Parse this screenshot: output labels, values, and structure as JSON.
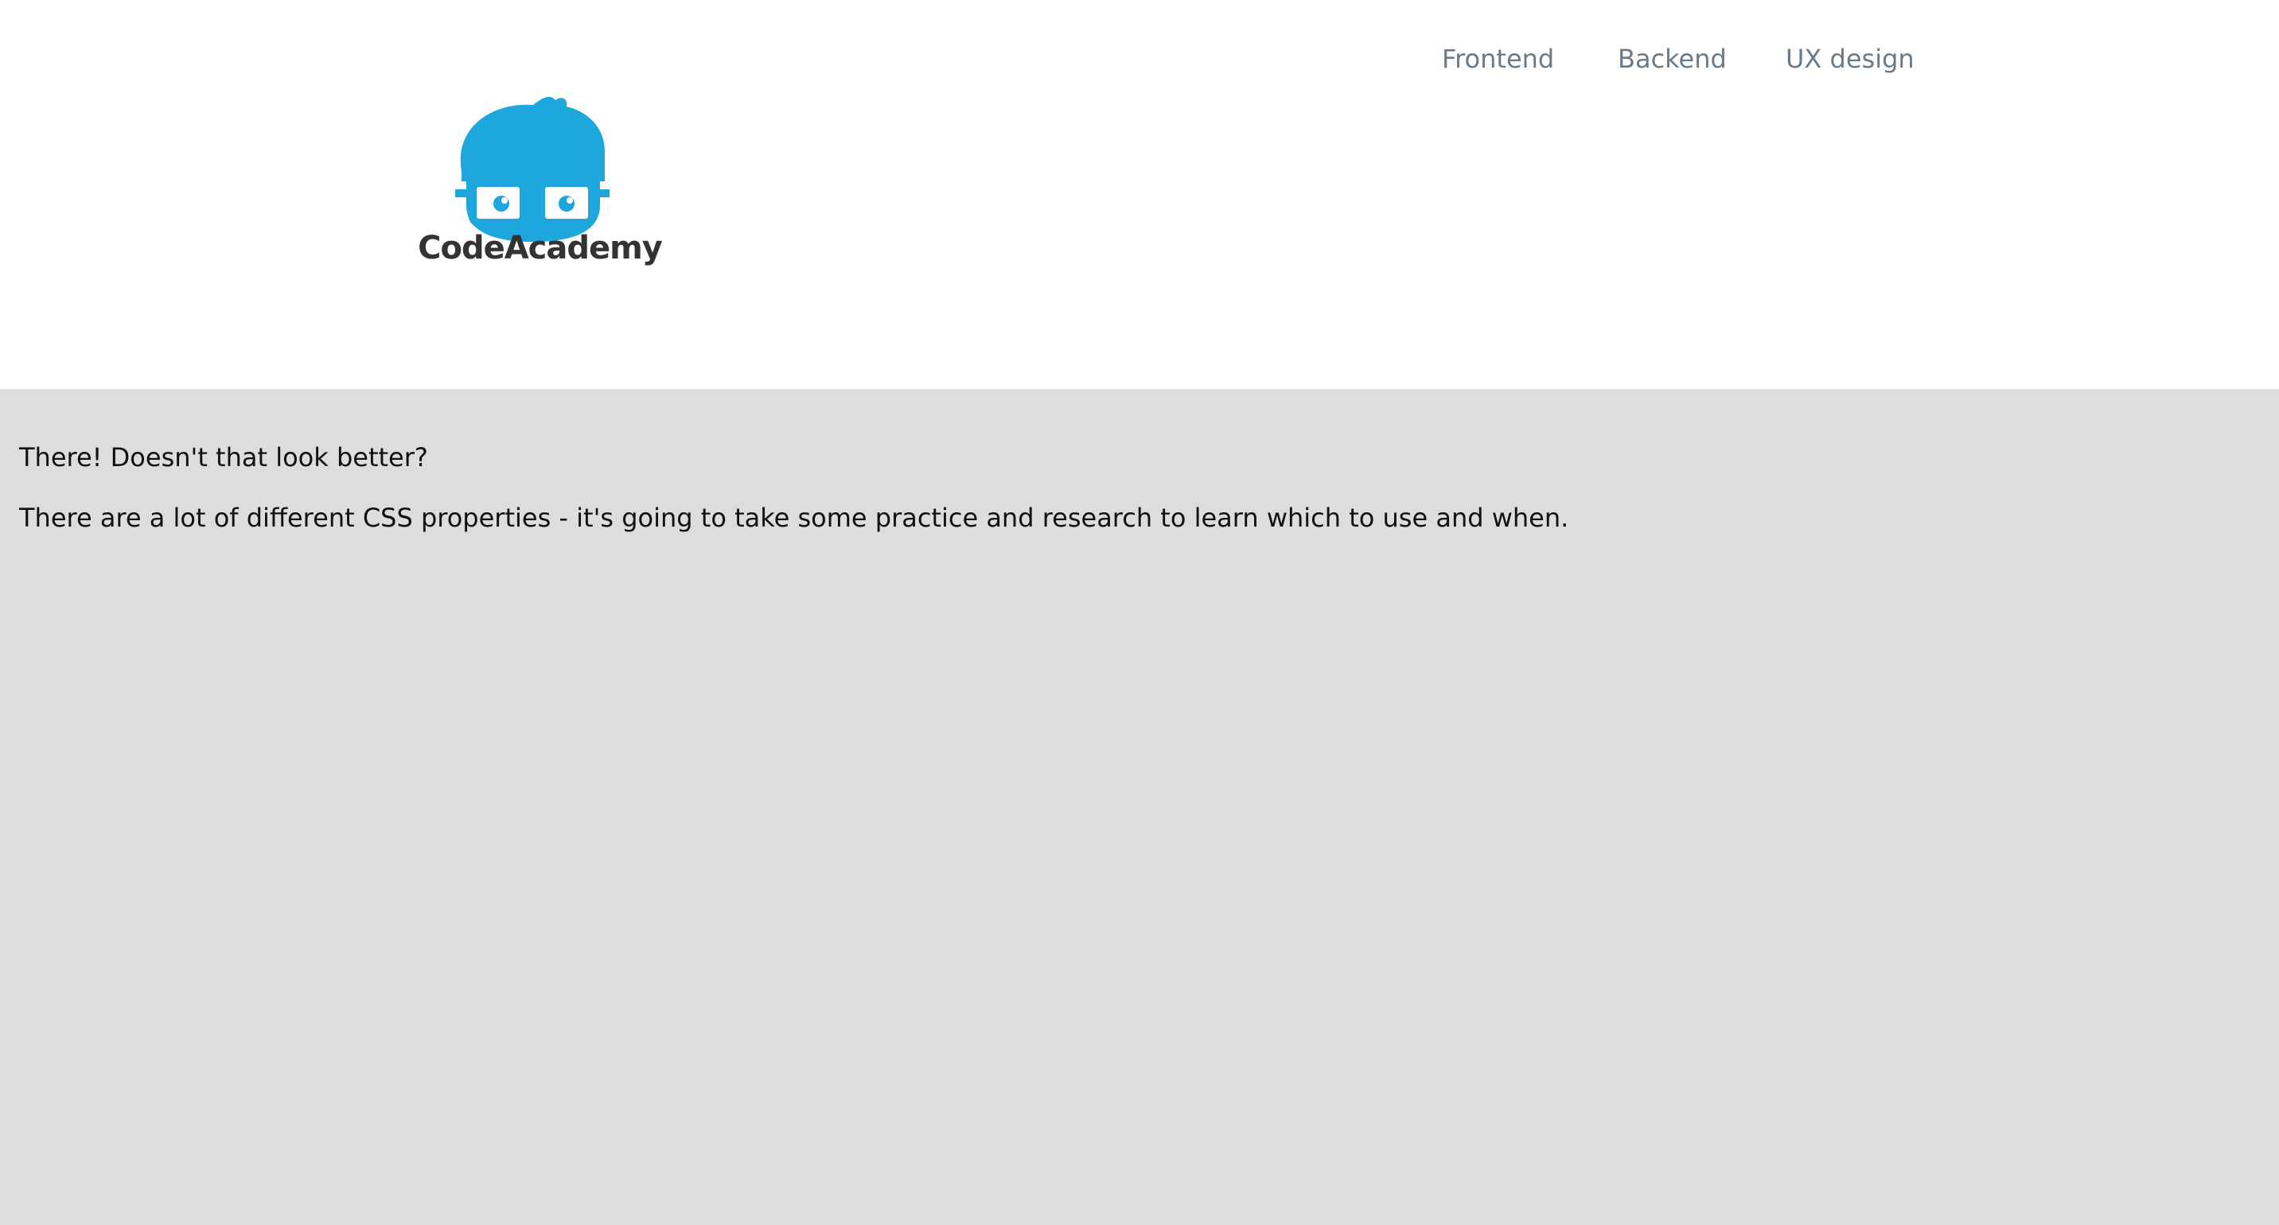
{
  "brand": {
    "name": "CodeAcademy",
    "logo_color": "#1ea7dc",
    "text_color": "#333333"
  },
  "nav": {
    "items": [
      {
        "label": "Frontend"
      },
      {
        "label": "Backend"
      },
      {
        "label": "UX design"
      }
    ],
    "text_color": "#6b7a87"
  },
  "content": {
    "paragraph_1": "There! Doesn't that look better?",
    "paragraph_2": "There are a lot of different CSS properties - it's going to take some practice and research to learn which to use and when."
  },
  "colors": {
    "header_bg": "#ffffff",
    "page_bg": "#dddddd",
    "body_text": "#111111"
  }
}
